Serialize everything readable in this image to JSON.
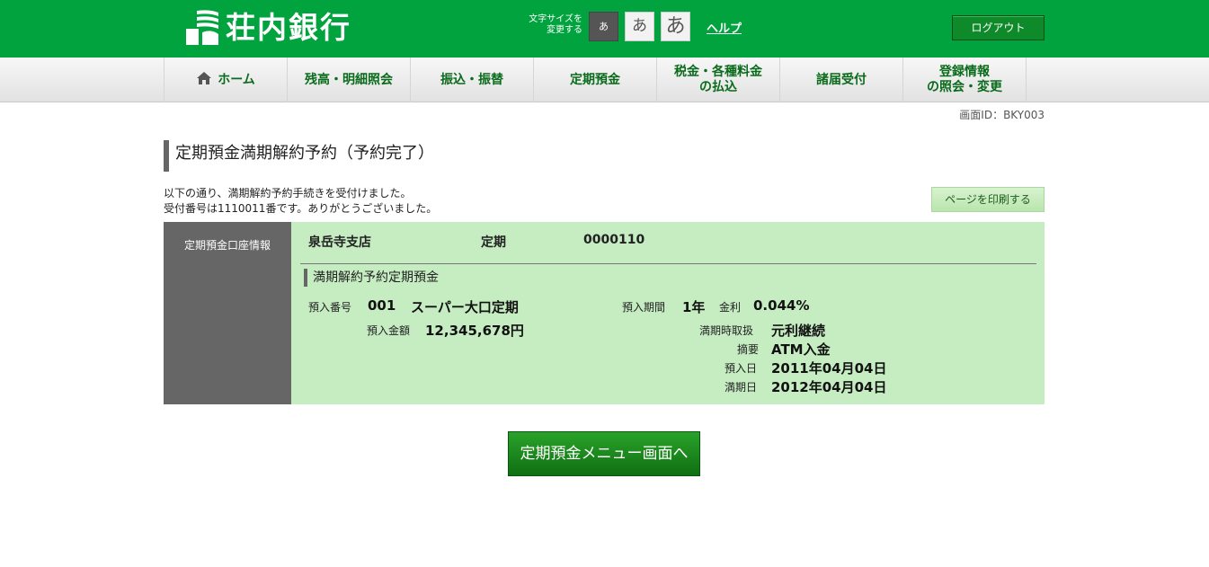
{
  "header": {
    "bank_name": "荘内銀行",
    "font_size_label_line1": "文字サイズを",
    "font_size_label_line2": "変更する",
    "font_small": "あ",
    "font_medium": "あ",
    "font_large": "あ",
    "help": "ヘルプ",
    "logout": "ログアウト"
  },
  "nav": {
    "home": "ホーム",
    "balance": "残高・明細照会",
    "transfer": "振込・振替",
    "time_deposit": "定期預金",
    "tax_line1": "税金・各種料金",
    "tax_line2": "の払込",
    "notifications": "諸届受付",
    "registration_line1": "登録情報",
    "registration_line2": "の照会・変更"
  },
  "screen_id": "画面ID：BKY003",
  "page_title": "定期預金満期解約予約（予約完了）",
  "message": {
    "line1": "以下の通り、満期解約予約手続きを受付けました。",
    "line2": "受付番号は1110011番です。ありがとうございました。"
  },
  "print_button": "ページを印刷する",
  "account": {
    "side_label": "定期預金口座情報",
    "branch": "泉岳寺支店",
    "type": "定期",
    "number": "0000110",
    "section_title": "満期解約予約定期預金",
    "deposit_no_label": "預入番号",
    "deposit_no": "001",
    "product": "スーパー大口定期",
    "amount_label": "預入金額",
    "amount": "12,345,678円",
    "period_label": "預入期間",
    "period": "1年",
    "rate_label": "金利",
    "rate": "0.044%",
    "maturity_handling_label": "満期時取扱",
    "maturity_handling": "元利継続",
    "summary_label": "摘要",
    "summary": "ATM入金",
    "deposit_date_label": "預入日",
    "deposit_date": "2011年04月04日",
    "maturity_date_label": "満期日",
    "maturity_date": "2012年04月04日"
  },
  "menu_button": "定期預金メニュー画面へ"
}
